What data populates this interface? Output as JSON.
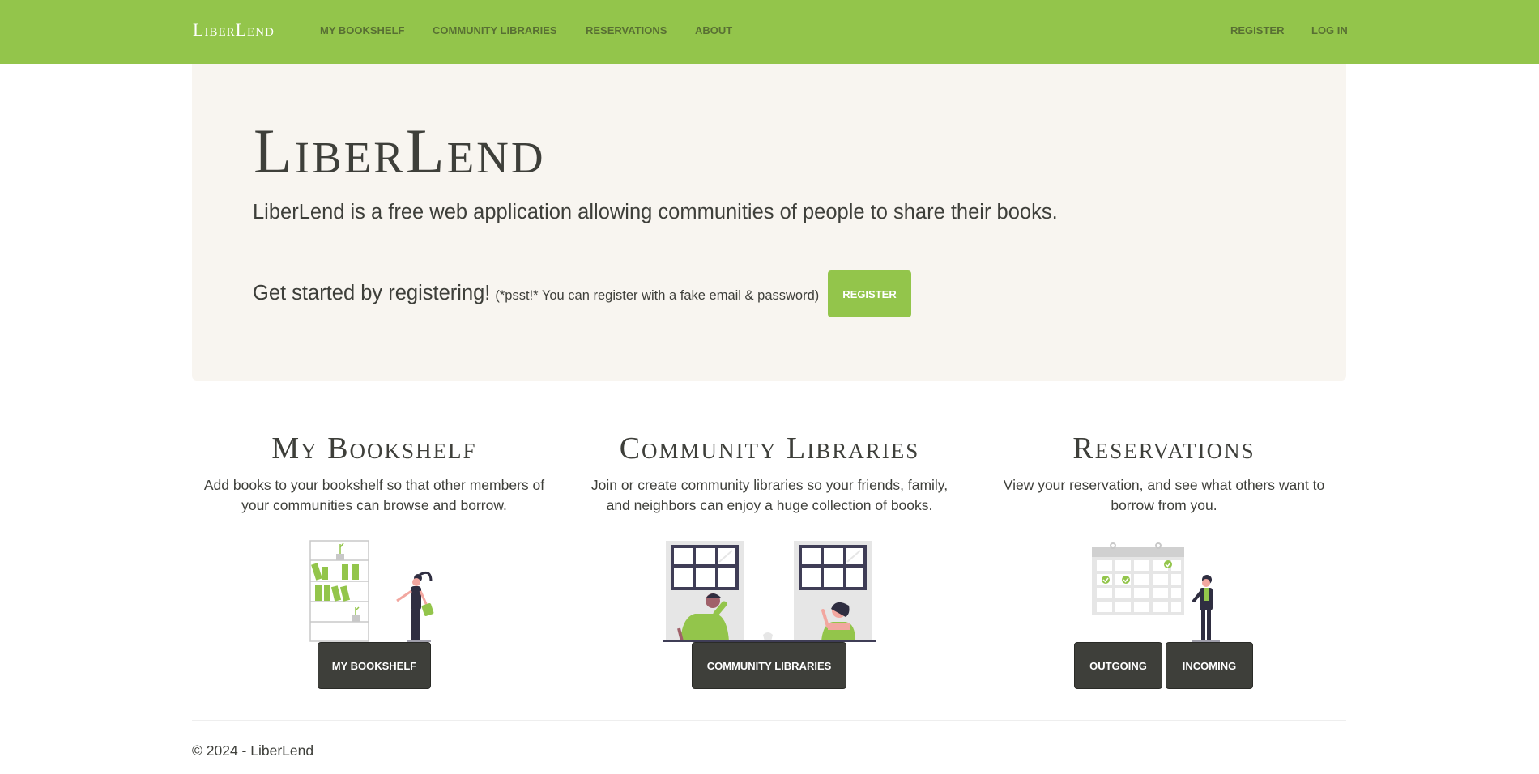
{
  "navbar": {
    "brand": "LiberLend",
    "links": [
      "My Bookshelf",
      "Community Libraries",
      "Reservations",
      "About"
    ],
    "right_links": [
      "Register",
      "Log in"
    ]
  },
  "hero": {
    "title": "LiberLend",
    "lead": "LiberLend is a free web application allowing communities of people to share their books.",
    "cta_text": "Get started by registering!",
    "cta_note": "(*psst!* You can register with a fake email & password)",
    "register_button": "Register"
  },
  "features": [
    {
      "title": "My Bookshelf",
      "description_lines": [
        "Add books to your bookshelf so that other members of",
        "your communities can browse and borrow."
      ],
      "buttons": [
        "My Bookshelf"
      ]
    },
    {
      "title": "Community Libraries",
      "description_lines": [
        "Join or create community libraries so your friends, family,",
        "and neighbors can enjoy a huge collection of books."
      ],
      "buttons": [
        "Community Libraries"
      ]
    },
    {
      "title": "Reservations",
      "description_lines": [
        "View your reservation, and see what others want to",
        "borrow from you."
      ],
      "buttons": [
        "Outgoing",
        "Incoming"
      ]
    }
  ],
  "footer": {
    "copyright": "© 2024 - LiberLend"
  },
  "colors": {
    "accent": "#93c54b",
    "dark": "#3e3f3a",
    "hero_bg": "#f8f5f0",
    "nav_link": "#586f33"
  },
  "icons": [
    "bookshelf-illustration",
    "community-windows-illustration",
    "calendar-reservation-illustration"
  ]
}
